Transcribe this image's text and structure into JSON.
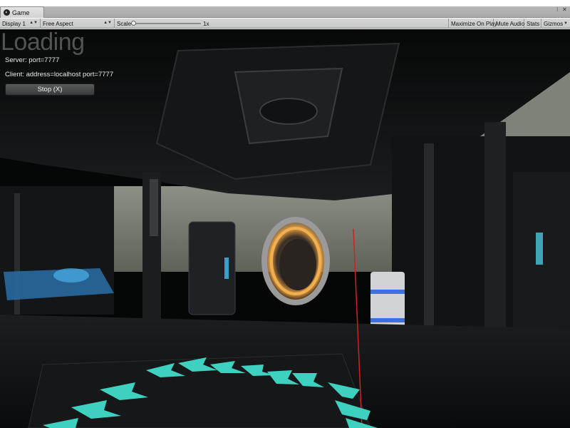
{
  "tab": {
    "title": "Game"
  },
  "toolbar": {
    "display": "Display 1",
    "aspect": "Free Aspect",
    "scale_label": "Scale",
    "scale_value": "1x",
    "maximize": "Maximize On Play",
    "mute": "Mute Audio",
    "stats": "Stats",
    "gizmos": "Gizmos"
  },
  "overlay": {
    "loading": "Loading",
    "server": "Server: port=7777",
    "client": "Client: address=localhost port=7777",
    "stop_button": "Stop (X)"
  },
  "colors": {
    "accent_teal": "#3fd1c0",
    "portal_orange": "#e8a040",
    "hologram_blue": "#3aa0e0"
  }
}
